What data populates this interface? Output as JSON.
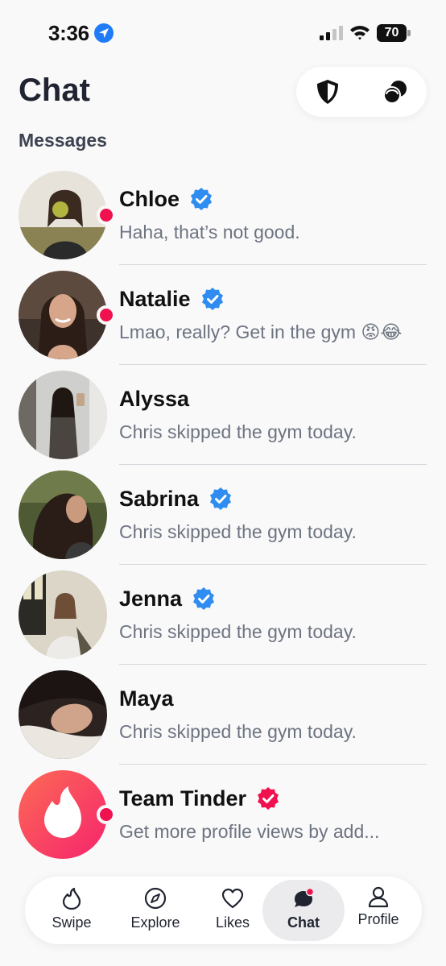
{
  "status_bar": {
    "time": "3:36",
    "battery": "70"
  },
  "header": {
    "title": "Chat",
    "safety_icon": "shield-icon",
    "matches_icon": "match-group-icon"
  },
  "section_title": "Messages",
  "chats": [
    {
      "name": "Chloe",
      "verified": true,
      "badge_color": "#2f8cf0",
      "preview": "Haha, that’s not good.",
      "unread": true
    },
    {
      "name": "Natalie",
      "verified": true,
      "badge_color": "#2f8cf0",
      "preview": "Lmao, really? Get in the gym 😡😂",
      "unread": true
    },
    {
      "name": "Alyssa",
      "verified": false,
      "preview": "Chris skipped the gym today.",
      "unread": false
    },
    {
      "name": "Sabrina",
      "verified": true,
      "badge_color": "#2f8cf0",
      "preview": "Chris skipped the gym today.",
      "unread": false
    },
    {
      "name": "Jenna",
      "verified": true,
      "badge_color": "#2f8cf0",
      "preview": "Chris skipped the gym today.",
      "unread": false
    },
    {
      "name": "Maya",
      "verified": false,
      "preview": "Chris skipped the gym today.",
      "unread": false
    },
    {
      "name": "Team Tinder",
      "verified": true,
      "badge_color": "#f0124f",
      "preview": "Get more profile views by add...",
      "unread": true
    }
  ],
  "tabs": [
    {
      "label": "Swipe",
      "icon": "flame-icon",
      "active": false
    },
    {
      "label": "Explore",
      "icon": "compass-icon",
      "active": false
    },
    {
      "label": "Likes",
      "icon": "heart-icon",
      "active": false
    },
    {
      "label": "Chat",
      "icon": "chat-bubble-icon",
      "active": true
    },
    {
      "label": "Profile",
      "icon": "person-icon",
      "active": false
    }
  ],
  "colors": {
    "accent": "#f0124f",
    "verified_blue": "#2f8cf0",
    "text_secondary": "#6d7480"
  }
}
